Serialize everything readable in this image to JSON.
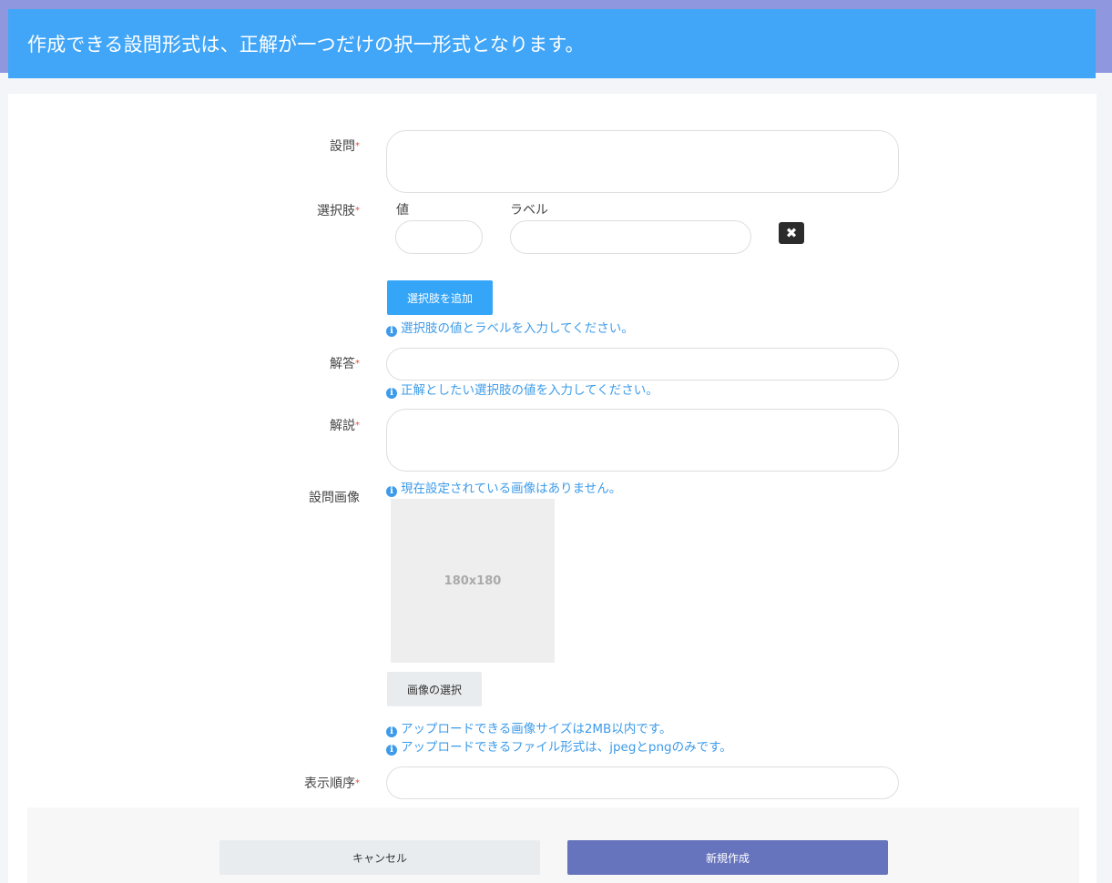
{
  "banner": {
    "text": "作成できる設問形式は、正解が一つだけの択一形式となります。"
  },
  "form": {
    "question": {
      "label": "設問",
      "required_mark": "*",
      "value": ""
    },
    "choices": {
      "label": "選択肢",
      "required_mark": "*",
      "value_header": "値",
      "label_header": "ラベル",
      "rows": [
        {
          "value": "",
          "label": ""
        }
      ],
      "remove_icon": "close-icon",
      "add_button": "選択肢を追加",
      "help": "選択肢の値とラベルを入力してください。"
    },
    "answer": {
      "label": "解答",
      "required_mark": "*",
      "value": "",
      "help": "正解としたい選択肢の値を入力してください。"
    },
    "explanation": {
      "label": "解説",
      "required_mark": "*",
      "value": ""
    },
    "image": {
      "label": "設問画像",
      "status": "現在設定されている画像はありません。",
      "placeholder_text": "180x180",
      "select_button": "画像の選択",
      "help_size": "アップロードできる画像サイズは2MB以内です。",
      "help_format": "アップロードできるファイル形式は、jpegとpngのみです。"
    },
    "order": {
      "label": "表示順序",
      "required_mark": "*",
      "value": ""
    }
  },
  "footer": {
    "cancel": "キャンセル",
    "create": "新規作成"
  },
  "icons": {
    "info": "info-icon",
    "info_glyph": "i"
  },
  "colors": {
    "banner": "#41a6f8",
    "accent": "#35a5f8",
    "primary": "#6673bd",
    "help_text": "#3d9be9",
    "required": "#e74c3c"
  }
}
